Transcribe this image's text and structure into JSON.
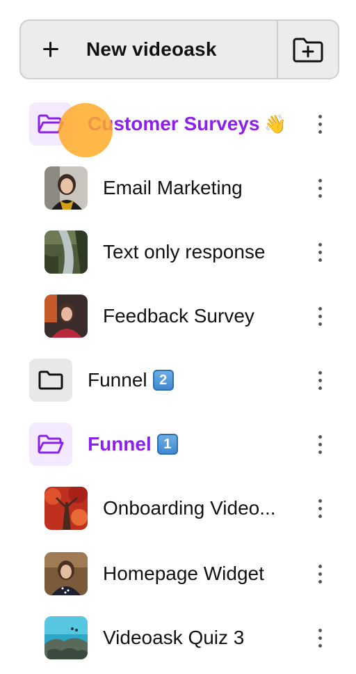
{
  "toolbar": {
    "new_label": "New videoask",
    "plus_icon": "plus-icon",
    "new_folder_icon": "folder-plus-icon"
  },
  "folders": [
    {
      "label": "Customer Surveys",
      "emoji": "👋",
      "state": "open",
      "items": [
        {
          "label": "Email Marketing"
        },
        {
          "label": "Text only response"
        },
        {
          "label": "Feedback Survey"
        }
      ]
    },
    {
      "label": "Funnel",
      "badge": "2",
      "state": "closed",
      "items": []
    },
    {
      "label": "Funnel",
      "badge": "1",
      "state": "open",
      "items": [
        {
          "label": "Onboarding Video..."
        },
        {
          "label": "Homepage Widget"
        },
        {
          "label": "Videoask Quiz 3"
        }
      ]
    }
  ],
  "colors": {
    "accent": "#8a1ff0",
    "accent_bg": "#f3eafe",
    "cursor": "#ffaa28"
  }
}
